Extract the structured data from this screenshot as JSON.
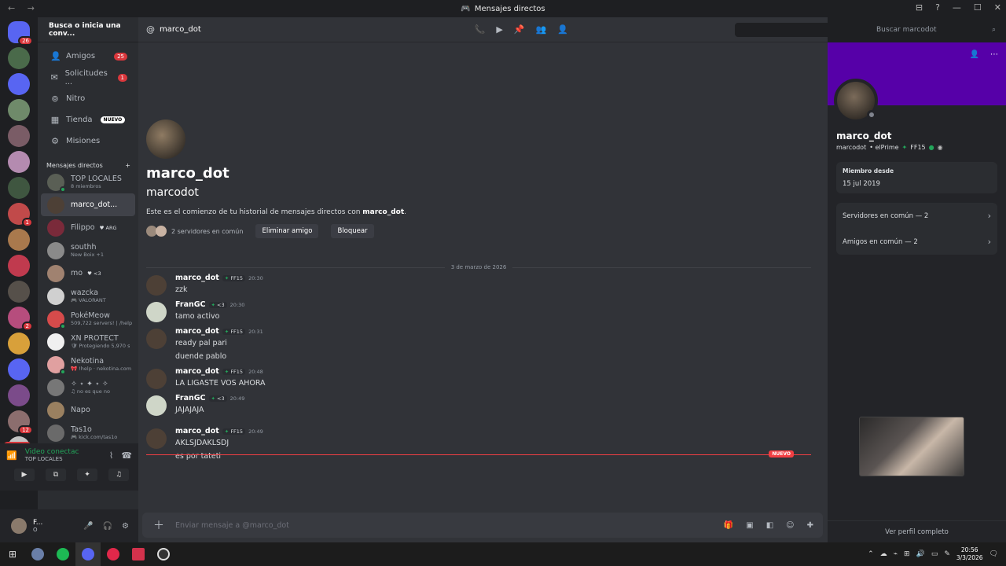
{
  "window": {
    "title": "Mensajes directos",
    "nav": "← →"
  },
  "servers": {
    "nuevo": "NUEVO",
    "items": [
      {
        "color": "#5865f2",
        "badge": "26"
      },
      {
        "color": "#4a6a4a",
        "badge": ""
      },
      {
        "color": "#5865f2",
        "badge": ""
      },
      {
        "color": "#6f8a6a",
        "badge": ""
      },
      {
        "color": "#7a5c66",
        "badge": ""
      },
      {
        "color": "#b48bb0",
        "badge": ""
      },
      {
        "color": "#3f5640",
        "badge": ""
      },
      {
        "color": "#c14a4a",
        "badge": "1"
      },
      {
        "color": "#a9794d",
        "badge": ""
      },
      {
        "color": "#c03a4e",
        "badge": ""
      },
      {
        "color": "#56504a",
        "badge": ""
      },
      {
        "color": "#b64d7d",
        "badge": "2"
      },
      {
        "color": "#d8a03a",
        "badge": ""
      },
      {
        "color": "#5865f2",
        "badge": ""
      },
      {
        "color": "#7b4b8a",
        "badge": ""
      },
      {
        "color": "#8c6e6e",
        "badge": "12"
      },
      {
        "color": "#c4c4c4",
        "badge": ""
      }
    ]
  },
  "sidebar": {
    "search_placeholder": "Busca o inicia una conv...",
    "nav": [
      {
        "label": "Amigos",
        "icon": "👤",
        "badge": "25",
        "tag": ""
      },
      {
        "label": "Solicitudes ...",
        "icon": "✉",
        "badge": "1",
        "tag": ""
      },
      {
        "label": "Nitro",
        "icon": "⊚",
        "badge": "",
        "tag": ""
      },
      {
        "label": "Tienda",
        "icon": "▦",
        "badge": "",
        "tag": "NUEVO"
      },
      {
        "label": "Misiones",
        "icon": "⚙",
        "badge": "",
        "tag": ""
      }
    ],
    "dm_header": "Mensajes directos",
    "dm_add": "+",
    "dms": [
      {
        "name": "TOP LOCALES",
        "sub": "8 miembros",
        "color": "#5a5f55",
        "status": true
      },
      {
        "name": "marco_dot...",
        "sub": "",
        "color": "#4d4036",
        "status": false,
        "active": true
      },
      {
        "name": "Filippo",
        "sub": "",
        "tag": "♥ ARG",
        "color": "#7a2a3a",
        "status": false
      },
      {
        "name": "southh",
        "sub": "New Boix +1",
        "color": "#8a8a8a",
        "status": false
      },
      {
        "name": "mo",
        "sub": "",
        "tag": "♥ <3",
        "color": "#a08270",
        "status": false
      },
      {
        "name": "wazcka",
        "sub": "🎮 VALORANT",
        "color": "#d0d0d0",
        "status": false
      },
      {
        "name": "PokéMeow",
        "sub": "509,722 servers! | /help",
        "color": "#d64b4b",
        "status": true
      },
      {
        "name": "XN PROTECT",
        "sub": "🛡 Protegiendo 5,970 s",
        "color": "#f0f0f0",
        "status": false
      },
      {
        "name": "Nekotina",
        "sub": "🎀 !help · nekotina.com",
        "color": "#e0a0a0",
        "status": true
      },
      {
        "name": "✧ ⋆ ✦ ⋆ ✧",
        "sub": "♫ no es que no",
        "color": "#777777",
        "status": false
      },
      {
        "name": "Napo",
        "sub": "",
        "color": "#9a8060",
        "status": false
      },
      {
        "name": "Tas1o",
        "sub": "🎮 kick.com/tas1o",
        "color": "#6a6a6a",
        "status": false
      }
    ]
  },
  "voice": {
    "title": "Video conectac",
    "channel": "TOP LOCALES"
  },
  "userbar": {
    "name": "F...",
    "sub": "O"
  },
  "header": {
    "name": "marco_dot",
    "search_placeholder": "Buscar marcodot"
  },
  "intro": {
    "name": "marco_dot",
    "username": "marcodot",
    "desc_prefix": "Este es el comienzo de tu historial de mensajes directos con ",
    "desc_name": "marco_dot",
    "desc_suffix": ".",
    "mutual": "2 servidores en común",
    "remove": "Eliminar amigo",
    "block": "Bloquear"
  },
  "date_divider": "3 de marzo de 2026",
  "messages": [
    {
      "author": "marco_dot",
      "tag": "FF15",
      "time": "20:30",
      "lines": [
        "zzk"
      ],
      "color": "#4d4036"
    },
    {
      "author": "FranGC",
      "tag": "<3",
      "time": "20:30",
      "lines": [
        "tamo activo"
      ],
      "color": "#cfd6c8"
    },
    {
      "author": "marco_dot",
      "tag": "FF15",
      "time": "20:31",
      "lines": [
        "ready pal pari",
        "duende pablo"
      ],
      "color": "#4d4036"
    },
    {
      "author": "marco_dot",
      "tag": "FF15",
      "time": "20:48",
      "lines": [
        "LA LIGASTE VOS AHORA"
      ],
      "color": "#4d4036"
    },
    {
      "author": "FranGC",
      "tag": "<3",
      "time": "20:49",
      "lines": [
        "JAJAJAJA"
      ],
      "color": "#cfd6c8"
    },
    {
      "author": "marco_dot",
      "tag": "FF15",
      "time": "20:49",
      "lines": [
        "AKLSJDAKLSDJ",
        "es por tateti"
      ],
      "color": "#4d4036"
    }
  ],
  "new_label": "NUEVO",
  "composer": {
    "placeholder": "Enviar mensaje a @marco_dot"
  },
  "profile": {
    "name": "marco_dot",
    "username": "marcodot",
    "extra": "• elPrime",
    "tag": "FF15",
    "member_label": "Miembro desde",
    "member_date": "15 jul 2019",
    "servers": "Servidores en común — 2",
    "friends": "Amigos en común — 2",
    "full": "Ver perfil completo",
    "banner_color": "#5600a8"
  },
  "taskbar": {
    "time": "20:56",
    "date": "3/3/2026"
  }
}
